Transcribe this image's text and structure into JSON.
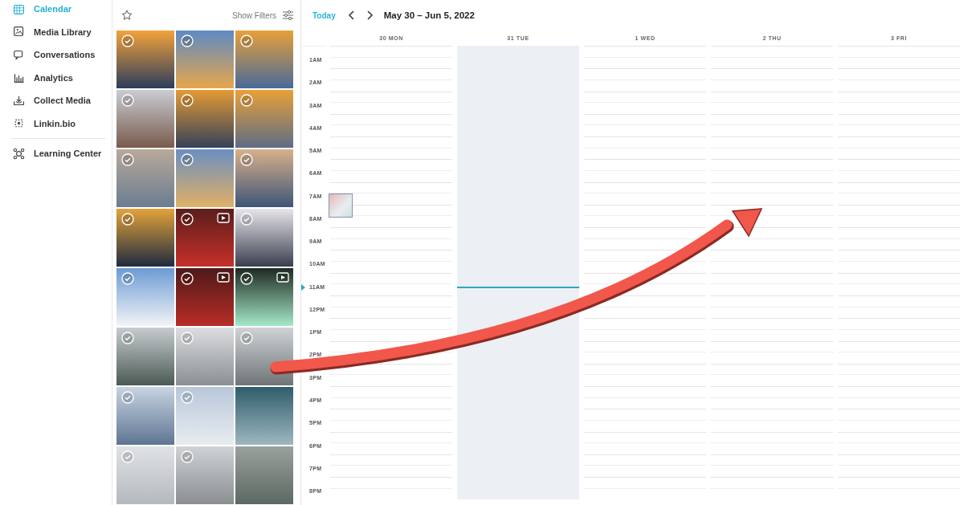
{
  "sidebar": {
    "items": [
      {
        "label": "Calendar",
        "selected": true
      },
      {
        "label": "Media Library",
        "selected": false
      },
      {
        "label": "Conversations",
        "selected": false
      },
      {
        "label": "Analytics",
        "selected": false
      },
      {
        "label": "Collect Media",
        "selected": false
      },
      {
        "label": "Linkin.bio",
        "selected": false
      }
    ],
    "footer_items": [
      {
        "label": "Learning Center",
        "selected": false
      }
    ]
  },
  "media_panel": {
    "filter_button": "Show Filters",
    "tiles": [
      {
        "kind": "photo",
        "checked": true
      },
      {
        "kind": "photo",
        "checked": true
      },
      {
        "kind": "photo",
        "checked": true
      },
      {
        "kind": "photo",
        "checked": true
      },
      {
        "kind": "photo",
        "checked": true
      },
      {
        "kind": "photo",
        "checked": true
      },
      {
        "kind": "photo",
        "checked": true
      },
      {
        "kind": "photo",
        "checked": true
      },
      {
        "kind": "photo",
        "checked": true
      },
      {
        "kind": "photo",
        "checked": true
      },
      {
        "kind": "video",
        "checked": true
      },
      {
        "kind": "photo",
        "checked": true
      },
      {
        "kind": "photo",
        "checked": true
      },
      {
        "kind": "video",
        "checked": true
      },
      {
        "kind": "video",
        "checked": true
      },
      {
        "kind": "photo",
        "checked": true
      },
      {
        "kind": "photo",
        "checked": true
      },
      {
        "kind": "photo",
        "checked": true
      },
      {
        "kind": "photo",
        "checked": true
      },
      {
        "kind": "photo",
        "checked": true
      },
      {
        "kind": "photo",
        "checked": false
      },
      {
        "kind": "photo",
        "checked": true
      },
      {
        "kind": "photo",
        "checked": true
      },
      {
        "kind": "photo",
        "checked": false
      }
    ]
  },
  "calendar": {
    "today_button": "Today",
    "range": "May 30 – Jun 5, 2022",
    "days": [
      {
        "label": "30 MON",
        "selected": false,
        "has_post": true
      },
      {
        "label": "31 TUE",
        "selected": true,
        "has_post": false
      },
      {
        "label": "1 WED",
        "selected": false,
        "has_post": false
      },
      {
        "label": "2 THU",
        "selected": false,
        "has_post": false
      },
      {
        "label": "3 FRI",
        "selected": false,
        "has_post": false
      }
    ],
    "hours": [
      "1AM",
      "2AM",
      "3AM",
      "4AM",
      "5AM",
      "6AM",
      "7AM",
      "8AM",
      "9AM",
      "10AM",
      "11AM",
      "12PM",
      "1PM",
      "2PM",
      "3PM",
      "4PM",
      "5PM",
      "6PM",
      "7PM",
      "8PM"
    ]
  }
}
